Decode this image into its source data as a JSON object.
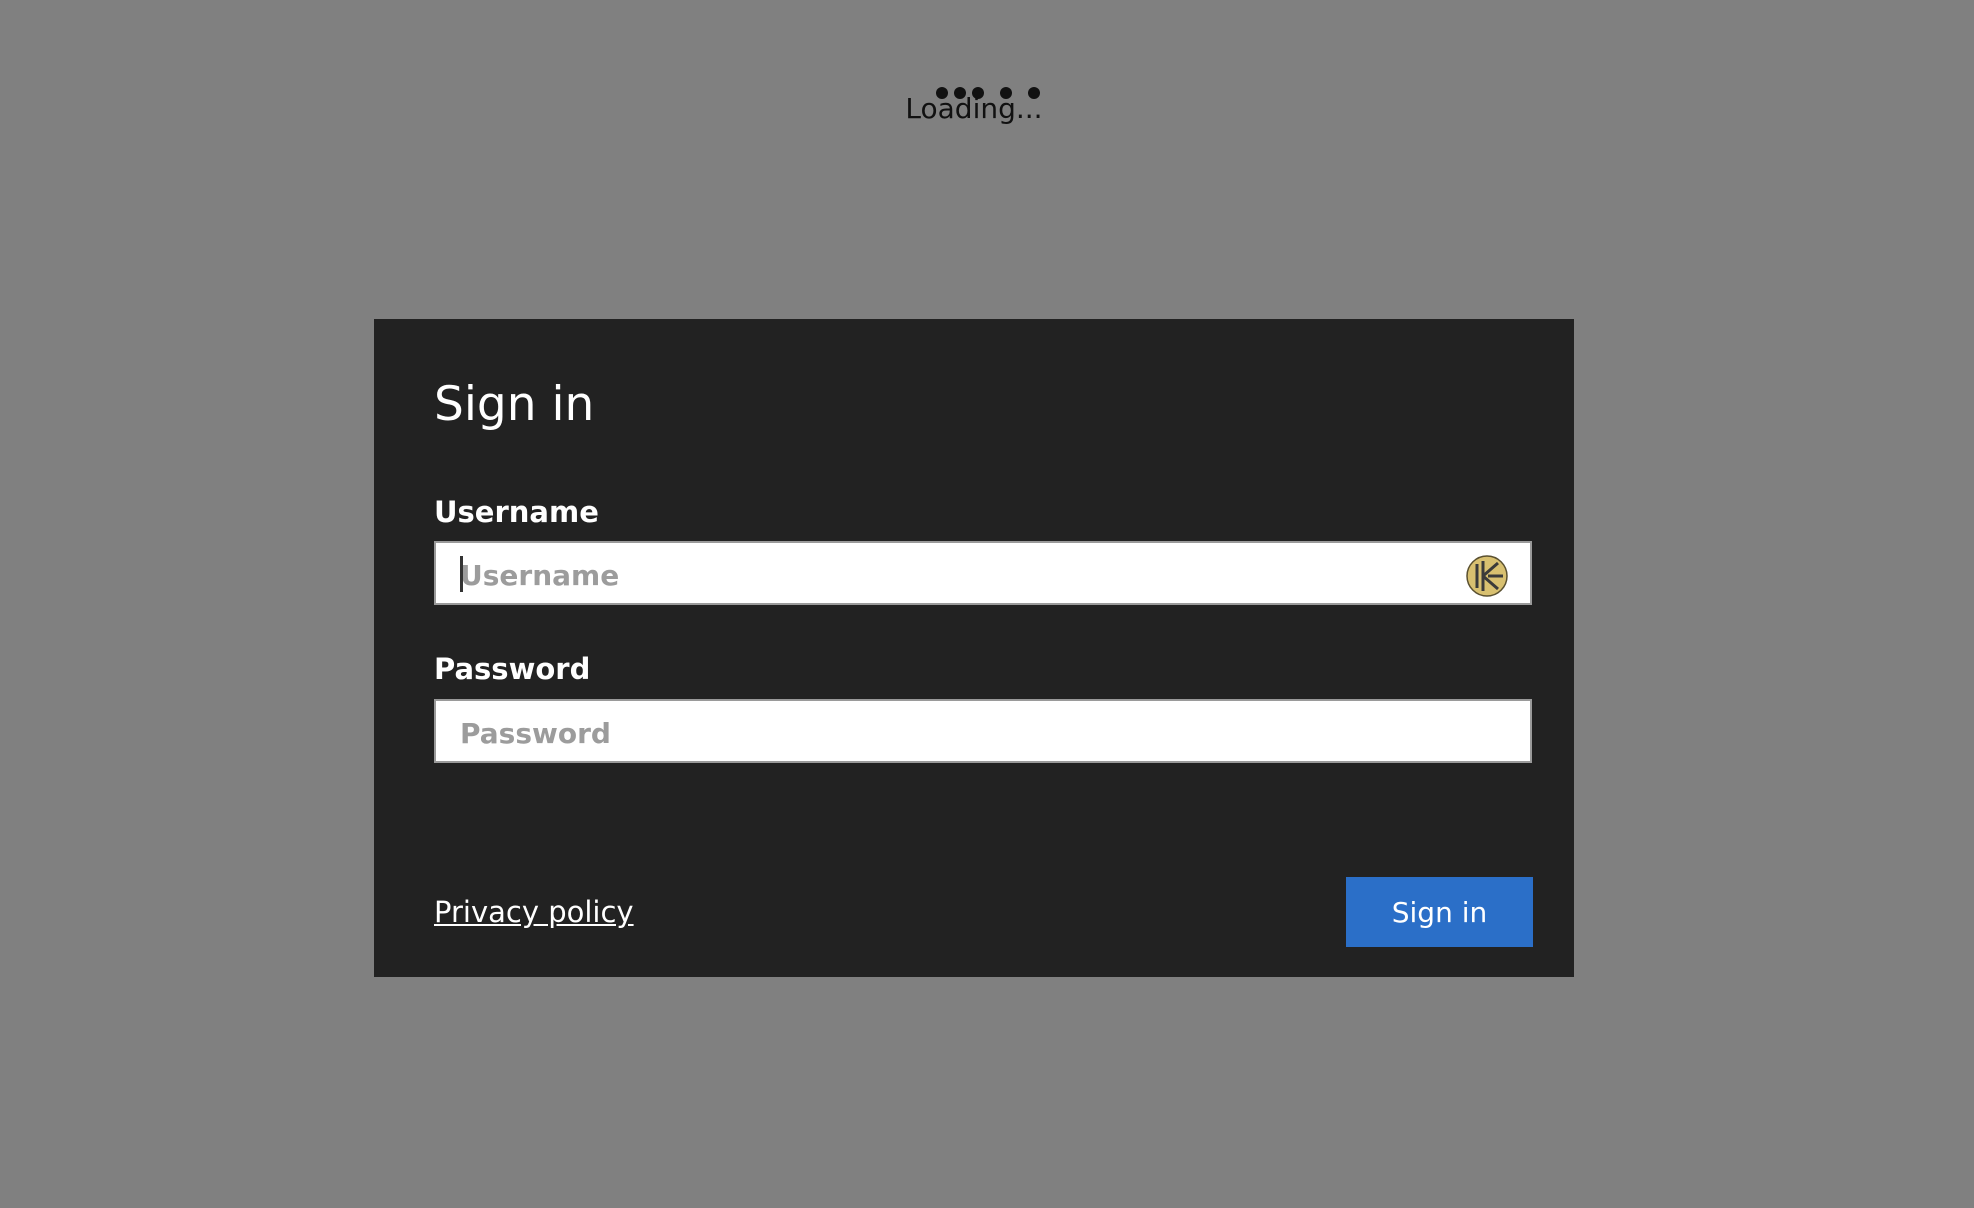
{
  "loading": {
    "text": "Loading..."
  },
  "dialog": {
    "title": "Sign in",
    "username": {
      "label": "Username",
      "placeholder": "Username",
      "value": ""
    },
    "password": {
      "label": "Password",
      "placeholder": "Password",
      "value": ""
    },
    "privacy_link": "Privacy policy",
    "submit_label": "Sign in"
  },
  "icons": {
    "password_manager": "keeper-icon"
  },
  "colors": {
    "background": "#808080",
    "dialog": "#222222",
    "button": "#2b6fc8",
    "keeper_icon": "#d8c070"
  }
}
